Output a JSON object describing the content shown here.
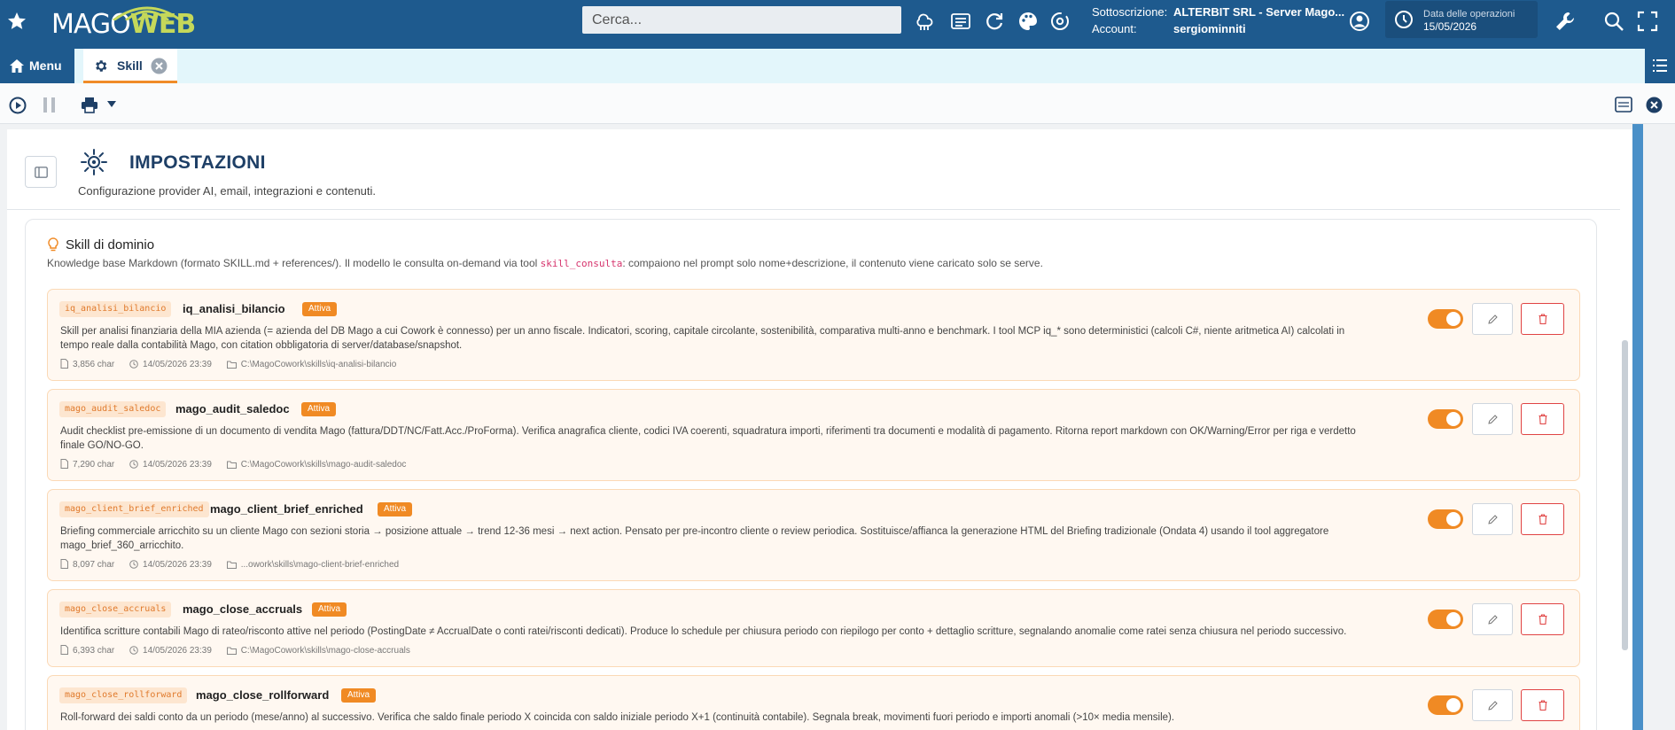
{
  "app": {
    "logo_mago": "MAGO",
    "logo_web": "WEB",
    "search_placeholder": "Cerca...",
    "subscription_label": "Sottoscrizione:",
    "subscription_value": "ALTERBIT SRL - Server Mago...",
    "account_label": "Account:",
    "account_value": "sergiominniti",
    "date_label": "Data delle operazioni",
    "date_value": "15/05/2026"
  },
  "tabs": {
    "menu_label": "Menu",
    "active_tab_label": "Skill"
  },
  "page": {
    "title": "IMPOSTAZIONI",
    "subtitle": "Configurazione provider AI, email, integrazioni e contenuti."
  },
  "section": {
    "title": "Skill di dominio",
    "desc_before": "Knowledge base Markdown (formato SKILL.md + references/). Il modello le consulta on-demand via tool ",
    "desc_code": "skill_consulta",
    "desc_after": ": compaiono nel prompt solo nome+descrizione, il contenuto viene caricato solo se serve."
  },
  "skills": [
    {
      "slug": "iq_analisi_bilancio",
      "name": "iq_analisi_bilancio",
      "status": "Attiva",
      "description": "Skill per analisi finanziaria della MIA azienda (= azienda del DB Mago a cui Cowork è connesso) per un anno fiscale. Indicatori, scoring, capitale circolante, sostenibilità, comparativa multi-anno e benchmark. I tool MCP iq_* sono deterministici (calcoli C#, niente aritmetica AI) calcolati in tempo reale dalla contabilità Mago, con citation obbligatoria di server/database/snapshot.",
      "size": "3,856 char",
      "date": "14/05/2026 23:39",
      "path": "C:\\MagoCowork\\skills\\iq-analisi-bilancio",
      "enabled": true
    },
    {
      "slug": "mago_audit_saledoc",
      "name": "mago_audit_saledoc",
      "status": "Attiva",
      "description": "Audit checklist pre-emissione di un documento di vendita Mago (fattura/DDT/NC/Fatt.Acc./ProForma). Verifica anagrafica cliente, codici IVA coerenti, squadratura importi, riferimenti tra documenti e modalità di pagamento. Ritorna report markdown con OK/Warning/Error per riga e verdetto finale GO/NO-GO.",
      "size": "7,290 char",
      "date": "14/05/2026 23:39",
      "path": "C:\\MagoCowork\\skills\\mago-audit-saledoc",
      "enabled": true
    },
    {
      "slug": "mago_client_brief_enriched",
      "name": "mago_client_brief_enriched",
      "status": "Attiva",
      "description": "Briefing commerciale arricchito su un cliente Mago con sezioni storia → posizione attuale → trend 12-36 mesi → next action. Pensato per pre-incontro cliente o review periodica. Sostituisce/affianca la generazione HTML del Briefing tradizionale (Ondata 4) usando il tool aggregatore mago_brief_360_arricchito.",
      "size": "8,097 char",
      "date": "14/05/2026 23:39",
      "path": "...owork\\skills\\mago-client-brief-enriched",
      "enabled": true
    },
    {
      "slug": "mago_close_accruals",
      "name": "mago_close_accruals",
      "status": "Attiva",
      "description": "Identifica scritture contabili Mago di rateo/risconto attive nel periodo (PostingDate ≠ AccrualDate o conti ratei/risconti dedicati). Produce lo schedule per chiusura periodo con riepilogo per conto + dettaglio scritture, segnalando anomalie come ratei senza chiusura nel periodo successivo.",
      "size": "6,393 char",
      "date": "14/05/2026 23:39",
      "path": "C:\\MagoCowork\\skills\\mago-close-accruals",
      "enabled": true
    },
    {
      "slug": "mago_close_rollforward",
      "name": "mago_close_rollforward",
      "status": "Attiva",
      "description": "Roll-forward dei saldi conto da un periodo (mese/anno) al successivo. Verifica che saldo finale periodo X coincida con saldo iniziale periodo X+1 (continuità contabile). Segnala break, movimenti fuori periodo e importi anomali (>10× media mensile).",
      "size": "",
      "date": "",
      "path": "",
      "enabled": true
    }
  ],
  "colors": {
    "primary": "#1e5a8e",
    "accent": "#f08a24",
    "logo_web": "#c5d85a",
    "danger": "#e04444"
  }
}
